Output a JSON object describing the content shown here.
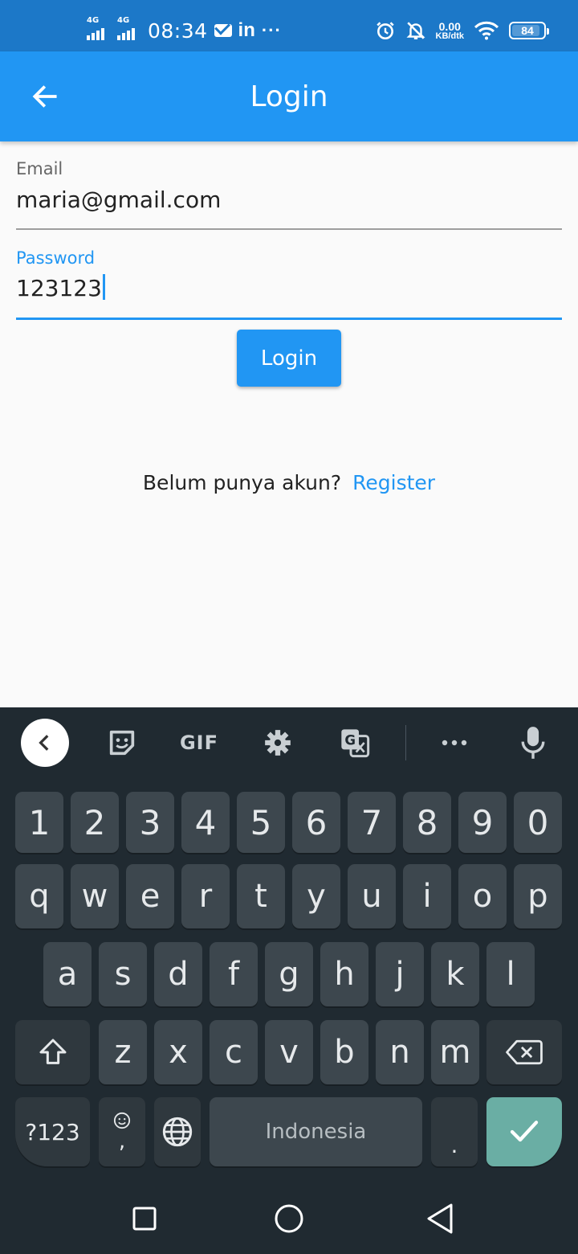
{
  "status_bar": {
    "network_1": "4G",
    "network_2": "4G",
    "time": "08:34",
    "app_icon_text": "in",
    "overflow": "···",
    "speed_value": "0.00",
    "speed_unit": "KB/dtk",
    "battery": "84"
  },
  "app_bar": {
    "title": "Login",
    "back_icon": "arrow-left-icon"
  },
  "form": {
    "email_label": "Email",
    "email_value": "maria@gmail.com",
    "password_label": "Password",
    "password_value": "123123",
    "login_button": "Login"
  },
  "register_prompt": {
    "question": "Belum punya akun?",
    "link": "Register"
  },
  "keyboard": {
    "toolbar": {
      "gif_label": "GIF",
      "icons": [
        "chevron-left-icon",
        "sticker-icon",
        "gif-icon",
        "settings-icon",
        "translate-icon",
        "more-icon",
        "microphone-icon"
      ]
    },
    "row_numbers": [
      "1",
      "2",
      "3",
      "4",
      "5",
      "6",
      "7",
      "8",
      "9",
      "0"
    ],
    "row_1": [
      "q",
      "w",
      "e",
      "r",
      "t",
      "y",
      "u",
      "i",
      "o",
      "p"
    ],
    "row_2": [
      "a",
      "s",
      "d",
      "f",
      "g",
      "h",
      "j",
      "k",
      "l"
    ],
    "row_3": [
      "z",
      "x",
      "c",
      "v",
      "b",
      "n",
      "m"
    ],
    "symbols_key": "?123",
    "comma_key": ",",
    "space_label": "Indonesia",
    "period_key": "."
  },
  "colors": {
    "status_bar": "#1c78c8",
    "primary": "#2196f3",
    "keyboard_bg": "#202a31",
    "key_bg": "#3d474e",
    "enter_key": "#6aaea4"
  }
}
